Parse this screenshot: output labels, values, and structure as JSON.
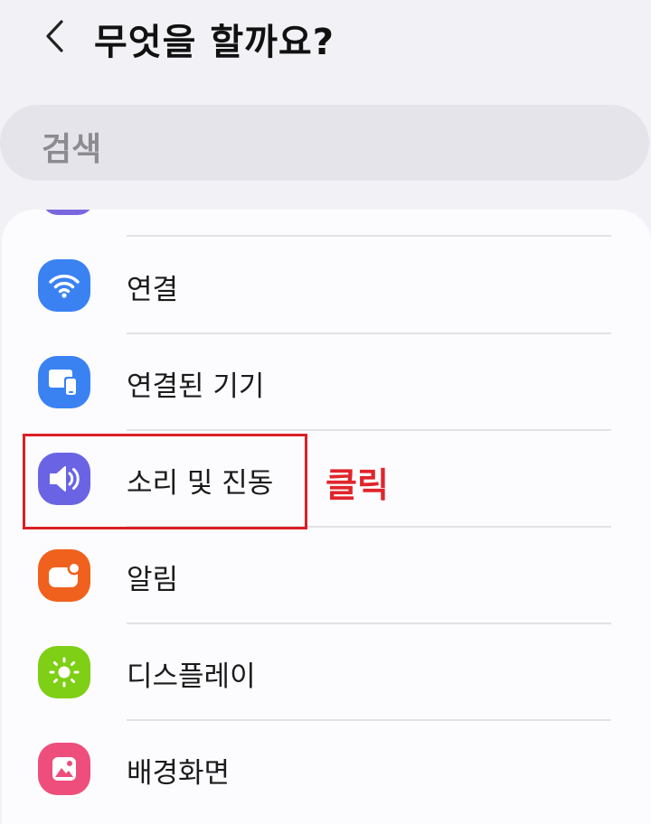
{
  "header": {
    "title": "무엇을 할까요?"
  },
  "search": {
    "label": "검색"
  },
  "items": [
    {
      "label": "연결",
      "icon": "wifi-icon",
      "color": "#3a82f2"
    },
    {
      "label": "연결된 기기",
      "icon": "connected-devices-icon",
      "color": "#3a82f2"
    },
    {
      "label": "소리 및 진동",
      "icon": "speaker-icon",
      "color": "#6a64e4"
    },
    {
      "label": "알림",
      "icon": "notification-icon",
      "color": "#f0611e"
    },
    {
      "label": "디스플레이",
      "icon": "sun-icon",
      "color": "#7ecf15"
    },
    {
      "label": "배경화면",
      "icon": "picture-icon",
      "color": "#ee4e7c"
    }
  ],
  "annotation": {
    "text": "클릭",
    "color": "#e0252b"
  }
}
